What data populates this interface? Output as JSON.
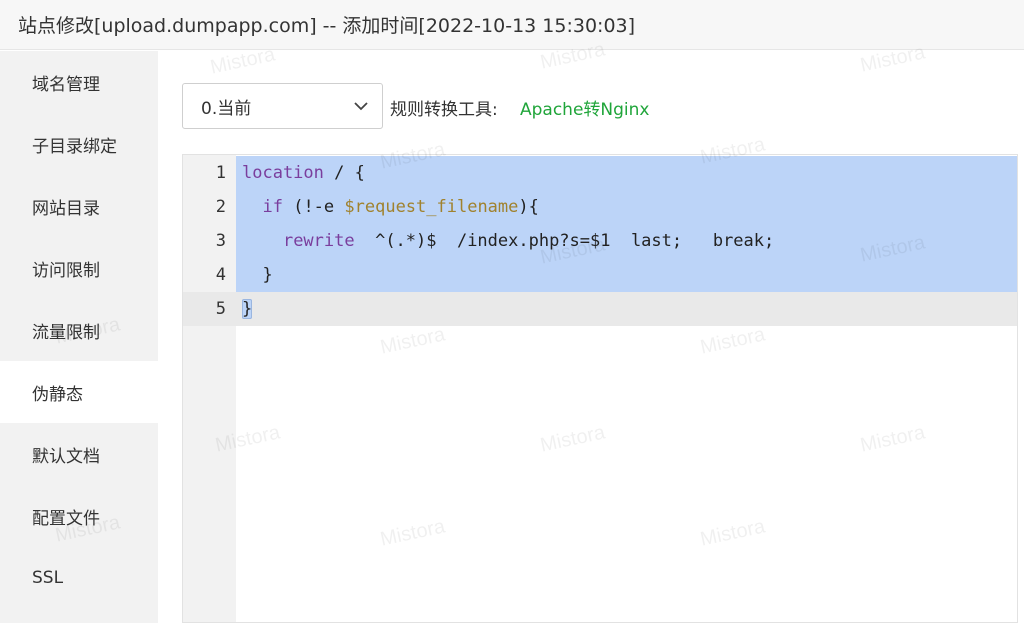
{
  "window": {
    "title": "站点修改[upload.dumpapp.com] -- 添加时间[2022-10-13 15:30:03]"
  },
  "sidebar": {
    "items": [
      {
        "label": "域名管理"
      },
      {
        "label": "子目录绑定"
      },
      {
        "label": "网站目录"
      },
      {
        "label": "访问限制"
      },
      {
        "label": "流量限制"
      },
      {
        "label": "伪静态",
        "active": true
      },
      {
        "label": "默认文档"
      },
      {
        "label": "配置文件"
      },
      {
        "label": "SSL"
      }
    ]
  },
  "toolbar": {
    "select_value": "0.当前",
    "tool_label": "规则转换工具:",
    "tool_link": "Apache转Nginx"
  },
  "editor": {
    "lines": [
      {
        "num": "1",
        "text": "location / {"
      },
      {
        "num": "2",
        "text": "  if (!-e $request_filename){"
      },
      {
        "num": "3",
        "text": "    rewrite  ^(.*)$  /index.php?s=$1  last;   break;"
      },
      {
        "num": "4",
        "text": "  }"
      },
      {
        "num": "5",
        "text": "}"
      }
    ]
  },
  "watermark": "Mistora",
  "colors": {
    "link": "#20a53a",
    "selection": "#bcd4f8",
    "sidebar_bg": "#f2f2f2"
  }
}
